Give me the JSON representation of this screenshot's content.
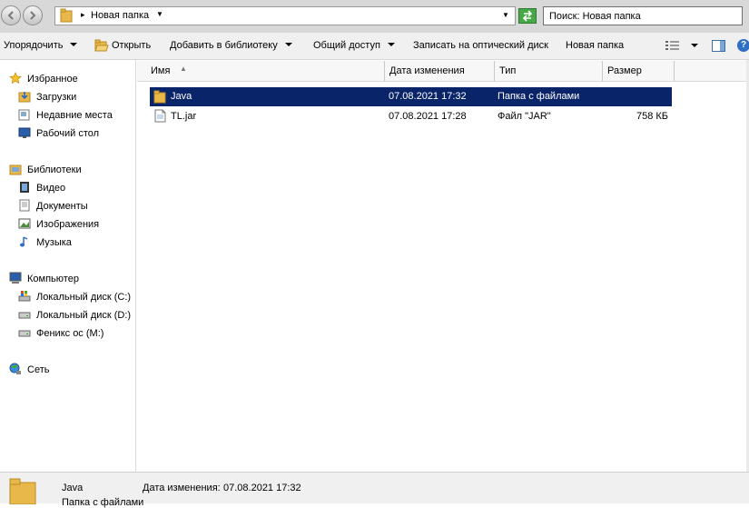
{
  "address": {
    "crumb": "Новая папка",
    "search_placeholder": "Поиск: Новая папка"
  },
  "toolbar": {
    "organize": "Упорядочить",
    "open": "Открыть",
    "add_to_library": "Добавить в библиотеку",
    "share": "Общий доступ",
    "burn": "Записать на оптический диск",
    "new_folder": "Новая папка"
  },
  "nav": {
    "favorites": "Избранное",
    "downloads": "Загрузки",
    "recent": "Недавние места",
    "desktop": "Рабочий стол",
    "libraries": "Библиотеки",
    "video": "Видео",
    "documents": "Документы",
    "images": "Изображения",
    "music": "Музыка",
    "computer": "Компьютер",
    "disk_c": "Локальный диск (C:)",
    "disk_d": "Локальный диск (D:)",
    "disk_m": "Феникс ос (M:)",
    "network": "Сеть"
  },
  "columns": {
    "name": "Имя",
    "date": "Дата изменения",
    "type": "Тип",
    "size": "Размер"
  },
  "files": [
    {
      "name": "Java",
      "date": "07.08.2021 17:32",
      "type": "Папка с файлами",
      "size": ""
    },
    {
      "name": "TL.jar",
      "date": "07.08.2021 17:28",
      "type": "Файл \"JAR\"",
      "size": "758 КБ"
    }
  ],
  "status": {
    "name": "Java",
    "sub": "Папка с файлами",
    "date_label": "Дата изменения:",
    "date_value": "07.08.2021 17:32"
  },
  "colors": {
    "selection": "#0a246a",
    "folder": "#e8b84a"
  }
}
